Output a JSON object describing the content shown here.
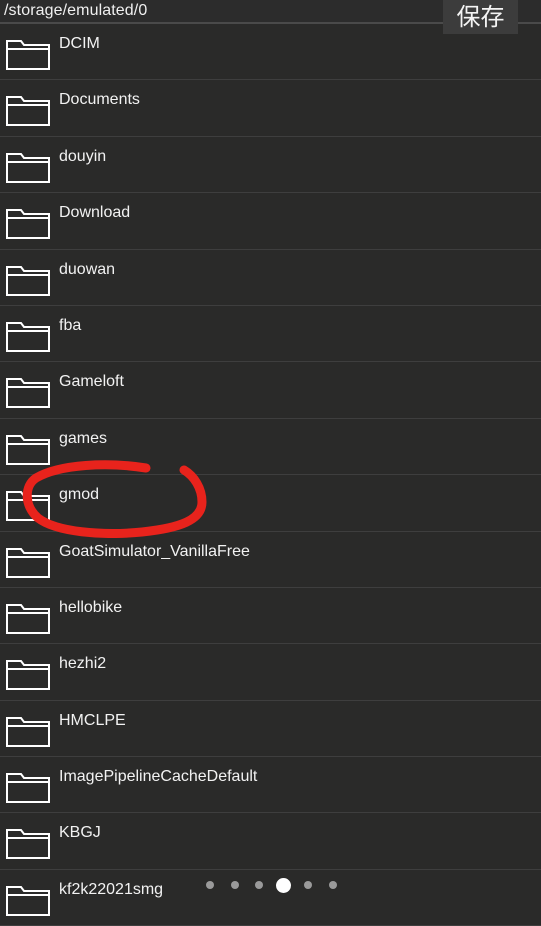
{
  "header": {
    "path": "/storage/emulated/0",
    "save_label": "保存"
  },
  "folders": [
    {
      "label": "DCIM"
    },
    {
      "label": "Documents"
    },
    {
      "label": "douyin"
    },
    {
      "label": "Download"
    },
    {
      "label": "duowan"
    },
    {
      "label": "fba"
    },
    {
      "label": "Gameloft"
    },
    {
      "label": "games"
    },
    {
      "label": "gmod"
    },
    {
      "label": "GoatSimulator_VanillaFree"
    },
    {
      "label": "hellobike"
    },
    {
      "label": "hezhi2"
    },
    {
      "label": "HMCLPE"
    },
    {
      "label": "ImagePipelineCacheDefault"
    },
    {
      "label": "KBGJ"
    },
    {
      "label": "kf2k22021smg"
    }
  ],
  "pager": {
    "count": 6,
    "active_index": 3
  },
  "colors": {
    "background": "#2a2a29",
    "annotation": "#e8231c",
    "icon_stroke": "#ffffff"
  }
}
